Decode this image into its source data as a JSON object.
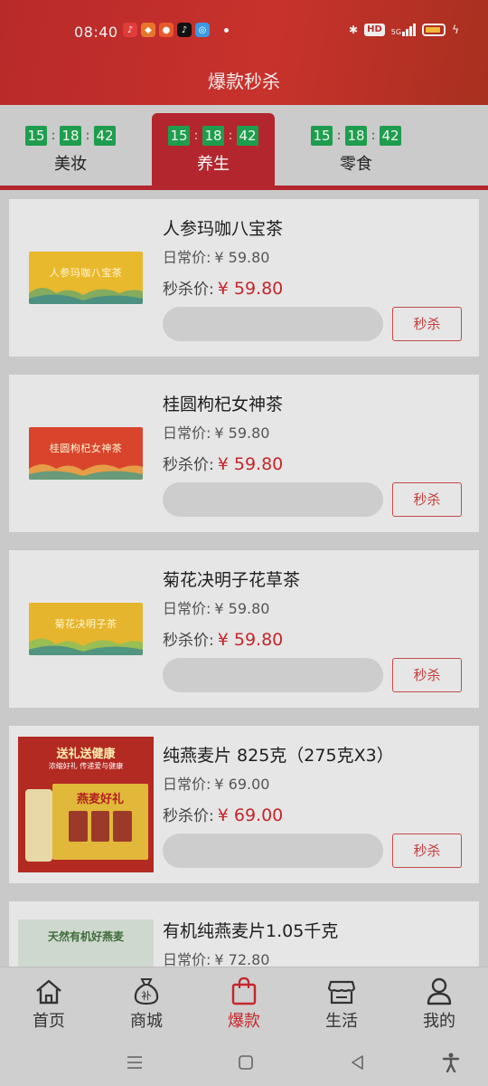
{
  "status_bar": {
    "time": "08:40",
    "signal_text": "5G"
  },
  "header": {
    "title": "爆款秒杀"
  },
  "tabs": [
    {
      "label": "美妆",
      "hh": "15",
      "mm": "18",
      "ss": "42",
      "active": false
    },
    {
      "label": "养生",
      "hh": "15",
      "mm": "18",
      "ss": "42",
      "active": true
    },
    {
      "label": "零食",
      "hh": "15",
      "mm": "18",
      "ss": "42",
      "active": false
    }
  ],
  "products": [
    {
      "name": "人参玛咖八宝茶",
      "regular_label": "日常价:",
      "regular_price": "¥ 59.80",
      "sale_label": "秒杀价:",
      "sale_price": "¥ 59.80",
      "button": "秒杀",
      "image_text": "人参玛咖八宝茶",
      "image_color": "#e9b92d"
    },
    {
      "name": "桂圆枸杞女神茶",
      "regular_label": "日常价:",
      "regular_price": "¥ 59.80",
      "sale_label": "秒杀价:",
      "sale_price": "¥ 59.80",
      "button": "秒杀",
      "image_text": "桂圆枸杞女神茶",
      "image_color": "#d9452c"
    },
    {
      "name": "菊花决明子花草茶",
      "regular_label": "日常价:",
      "regular_price": "¥ 59.80",
      "sale_label": "秒杀价:",
      "sale_price": "¥ 59.80",
      "button": "秒杀",
      "image_text": "菊花决明子茶",
      "image_color": "#e6b52e"
    },
    {
      "name": "纯燕麦片 825克（275克X3）",
      "regular_label": "日常价:",
      "regular_price": "¥ 69.00",
      "sale_label": "秒杀价:",
      "sale_price": "¥ 69.00",
      "button": "秒杀",
      "image_title": "送礼送健康",
      "image_sub": "浓缩好礼 传递爱与健康",
      "image_box_text": "燕麦好礼"
    },
    {
      "name": "有机纯燕麦片1.05千克",
      "regular_label": "日常价:",
      "regular_price": "¥ 72.80",
      "image_title": "天然有机好燕麦"
    }
  ],
  "bottom_nav": [
    {
      "label": "首页",
      "icon": "home-icon",
      "active": false
    },
    {
      "label": "商城",
      "icon": "money-bag-icon",
      "active": false,
      "icon_text": "补"
    },
    {
      "label": "爆款",
      "icon": "shopping-bag-icon",
      "active": true
    },
    {
      "label": "生活",
      "icon": "store-icon",
      "active": false
    },
    {
      "label": "我的",
      "icon": "user-icon",
      "active": false
    }
  ],
  "colors": {
    "brand_red": "#b3262d",
    "price_red": "#c4262b",
    "timer_green": "#1f9d4e"
  }
}
